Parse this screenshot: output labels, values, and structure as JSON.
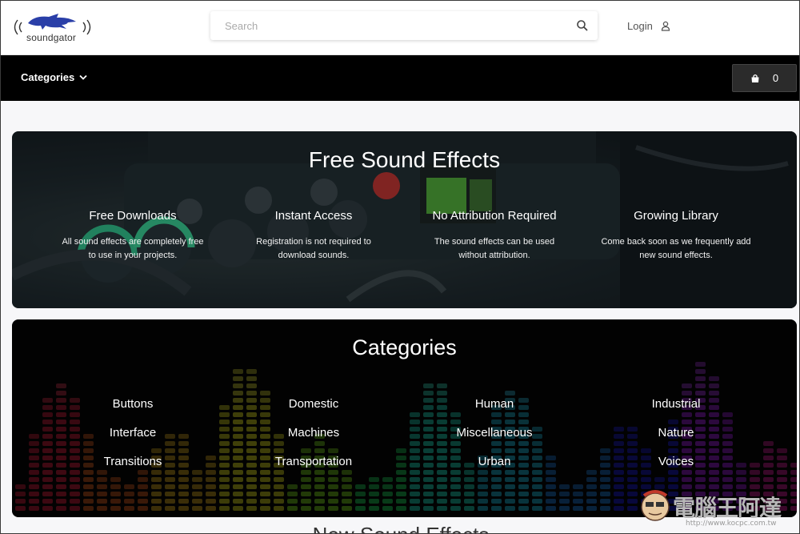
{
  "header": {
    "logo_text": "soundgator",
    "search_placeholder": "Search",
    "login_label": "Login"
  },
  "nav": {
    "categories_label": "Categories",
    "cart_count": "0"
  },
  "hero": {
    "title": "Free Sound Effects",
    "features": [
      {
        "title": "Free Downloads",
        "desc1": "All sound effects are completely free",
        "desc2": "to use in your projects."
      },
      {
        "title": "Instant Access",
        "desc1": "Registration is not required to",
        "desc2": "download sounds."
      },
      {
        "title": "No Attribution Required",
        "desc1": "The sound effects can be used",
        "desc2": "without attribution."
      },
      {
        "title": "Growing Library",
        "desc1": "Come back soon as we frequently add",
        "desc2": "new sound effects."
      }
    ]
  },
  "categories": {
    "title": "Categories",
    "items": [
      "Buttons",
      "Domestic",
      "Human",
      "Industrial",
      "Interface",
      "Machines",
      "Miscellaneous",
      "Nature",
      "Transitions",
      "Transportation",
      "Urban",
      "Voices"
    ]
  },
  "new_section": {
    "title": "New Sound Effects"
  },
  "watermark": {
    "text": "電腦王阿達",
    "url": "http://www.kocpc.com.tw"
  },
  "colors": {
    "navbar": "#000000",
    "cart_button": "#2b2b2b",
    "logo_blue": "#2a3fa8"
  }
}
